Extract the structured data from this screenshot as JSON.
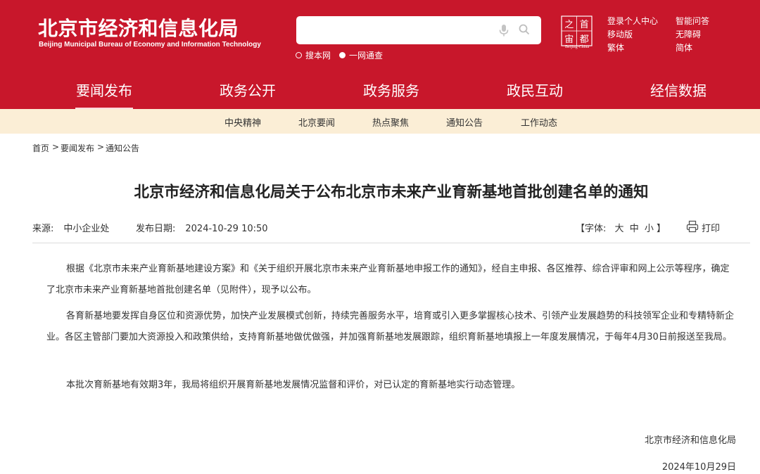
{
  "header": {
    "site_name_cn": "北京市经济和信息化局",
    "site_name_en": "Beijing Municipal Bureau of Economy and Information Technology",
    "search": {
      "value": "",
      "mic_icon": "microphone-icon",
      "search_icon": "search-icon",
      "scopes": [
        {
          "label": "搜本网",
          "selected": false
        },
        {
          "label": "一网通查",
          "selected": true
        }
      ]
    },
    "seal": {
      "chars": [
        "之",
        "首",
        "宙",
        "都"
      ],
      "caption": "Beijing-China"
    },
    "utility_links": {
      "login": "登录个人中心",
      "mobile": "移动版",
      "traditional": "繁体",
      "smart_qa": "智能问答",
      "accessibility": "无障碍",
      "simplified": "简体"
    }
  },
  "main_nav": [
    {
      "label": "要闻发布",
      "active": true
    },
    {
      "label": "政务公开",
      "active": false
    },
    {
      "label": "政务服务",
      "active": false
    },
    {
      "label": "政民互动",
      "active": false
    },
    {
      "label": "经信数据",
      "active": false
    }
  ],
  "sub_nav": [
    "中央精神",
    "北京要闻",
    "热点聚焦",
    "通知公告",
    "工作动态"
  ],
  "breadcrumb": {
    "items": [
      "首页",
      "要闻发布",
      "通知公告"
    ],
    "separator": ">"
  },
  "article": {
    "title": "北京市经济和信息化局关于公布北京市未来产业育新基地首批创建名单的通知",
    "source_label": "来源:",
    "source": "中小企业处",
    "date_label": "发布日期:",
    "date": "2024-10-29 10:50",
    "font_size_label": "【字体:",
    "font_size_options": [
      "大",
      "中",
      "小"
    ],
    "font_size_end": "】",
    "print_label": "打印",
    "print_icon": "printer-icon",
    "paragraphs": [
      "根据《北京市未来产业育新基地建设方案》和《关于组织开展北京市未来产业育新基地申报工作的通知》，经自主申报、各区推荐、综合评审和网上公示等程序，确定了北京市未来产业育新基地首批创建名单（见附件），现予以公布。",
      "各育新基地要发挥自身区位和资源优势，加快产业发展模式创新，持续完善服务水平，培育或引入更多掌握核心技术、引领产业发展趋势的科技领军企业和专精特新企业。各区主管部门要加大资源投入和政策供给，支持育新基地做优做强，并加强育新基地发展跟踪，组织育新基地填报上一年度发展情况，于每年4月30日前报送至我局。",
      "本批次育新基地有效期3年，我局将组织开展育新基地发展情况监督和评价，对已认定的育新基地实行动态管理。"
    ],
    "signature": "北京市经济和信息化局",
    "sign_date": "2024年10月29日"
  },
  "colors": {
    "brand_red": "#c8172b",
    "subnav_bg": "#fbeed6",
    "text": "#333333"
  }
}
